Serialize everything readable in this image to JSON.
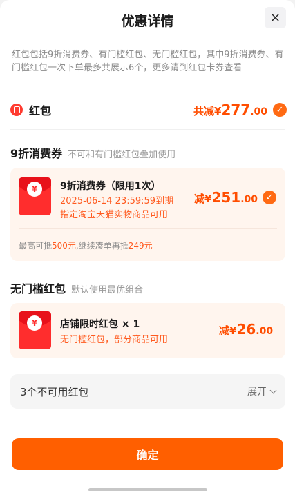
{
  "header": {
    "title": "优惠详情",
    "close_icon": "×"
  },
  "description": "红包包括9折消费券、有门槛红包、无门槛红包，其中9折消费券、有门槛红包一次下单最多共展示6个，更多请到红包卡券查看",
  "total": {
    "label": "红包",
    "prefix": "共减¥",
    "amount_int": "277",
    "amount_dec": ".00",
    "checked": true
  },
  "section_discount": {
    "heading": "9折消费券",
    "note": "不可和有门槛红包叠加使用",
    "coupon": {
      "icon_symbol": "¥",
      "title": "9折消费券（限用1次）",
      "expiry": "2025-06-14 23:59:59到期",
      "scope": "指定淘宝天猫实物商品可用",
      "prefix": "减¥",
      "amount_int": "251",
      "amount_dec": ".00",
      "checked": true
    },
    "footnote": {
      "part1": "最高可抵",
      "max": "500元",
      "part2": ",继续凑单再抵",
      "more": "249元"
    }
  },
  "section_nothreshold": {
    "heading": "无门槛红包",
    "note": "默认使用最优组合",
    "coupon": {
      "icon_symbol": "¥",
      "title": "店铺限时红包 × 1",
      "scope": "无门槛红包，部分商品可用",
      "prefix": "减¥",
      "amount_int": "26",
      "amount_dec": ".00"
    }
  },
  "unavailable": {
    "label": "3个不可用红包",
    "expand": "展开"
  },
  "confirm_label": "确定",
  "colors": {
    "accent": "#ff5f00",
    "price": "#ff4d00",
    "card_bg": "#fff5ee"
  }
}
